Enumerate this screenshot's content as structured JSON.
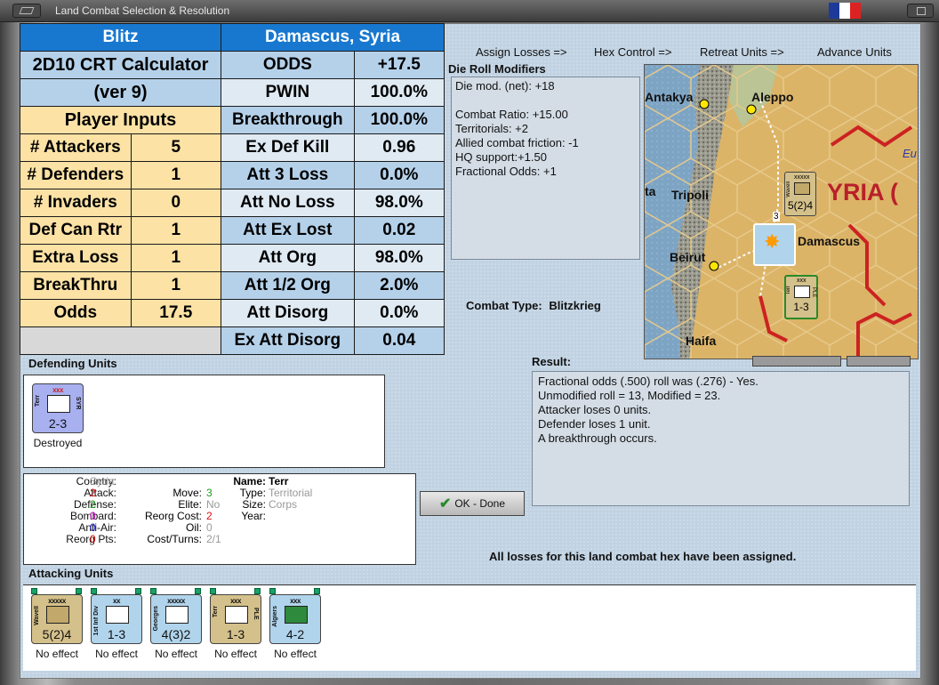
{
  "window": {
    "title": "Land Combat Selection & Resolution"
  },
  "crt": {
    "blitz": "Blitz",
    "location": "Damascus, Syria",
    "calc_title": "2D10 CRT Calculator",
    "calc_ver": "(ver 9)",
    "player_inputs": "Player Inputs",
    "inputs": [
      {
        "label": "# Attackers",
        "value": "5"
      },
      {
        "label": "# Defenders",
        "value": "1"
      },
      {
        "label": "# Invaders",
        "value": "0"
      },
      {
        "label": "Def Can Rtr",
        "value": "1"
      },
      {
        "label": "Extra Loss",
        "value": "1"
      },
      {
        "label": "BreakThru",
        "value": "1"
      },
      {
        "label": "Odds",
        "value": "17.5"
      }
    ],
    "results": [
      {
        "label": "ODDS",
        "value": "+17.5"
      },
      {
        "label": "PWIN",
        "value": "100.0%"
      },
      {
        "label": "Breakthrough",
        "value": "100.0%"
      },
      {
        "label": "Ex Def Kill",
        "value": "0.96"
      },
      {
        "label": "Att 3 Loss",
        "value": "0.0%"
      },
      {
        "label": "Att No Loss",
        "value": "98.0%"
      },
      {
        "label": "Att Ex Lost",
        "value": "0.02"
      },
      {
        "label": "Att Org",
        "value": "98.0%"
      },
      {
        "label": "Att 1/2 Org",
        "value": "2.0%"
      },
      {
        "label": "Att Disorg",
        "value": "0.0%"
      },
      {
        "label": "Ex Att Disorg",
        "value": "0.04"
      }
    ]
  },
  "actions": {
    "assign_losses": "Assign Losses =>",
    "hex_control": "Hex Control =>",
    "retreat_units": "Retreat Units =>",
    "advance_units": "Advance Units"
  },
  "modifiers": {
    "title": "Die Roll Modifiers",
    "lines": [
      "Die mod. (net): +18",
      "",
      "Combat Ratio: +15.00",
      "Territorials: +2",
      "Allied combat friction: -1",
      "HQ support:+1.50",
      "Fractional Odds: +1"
    ]
  },
  "map": {
    "labels": {
      "antakya": "Antakya",
      "aleppo": "Aleppo",
      "tripoli": "Tripoli",
      "beirut": "Beirut",
      "damascus": "Damascus",
      "haifa": "Haifa",
      "syria": "YRIA (",
      "ta": "ta",
      "eu": "Eu"
    },
    "hq_strength": "5(2)4",
    "hq_size": "xxxxx",
    "hq_name": "Wavell",
    "terr_strength": "1-3",
    "terr_size": "xxx",
    "terr_name": "Terr",
    "terr_country": "PLE",
    "stack_count": "3"
  },
  "combat": {
    "label": "Combat Type:",
    "value": "Blitzkrieg"
  },
  "defending": {
    "title": "Defending Units",
    "units": [
      {
        "size": "xxx",
        "name": "Terr",
        "country": "SYR",
        "strength": "2-3",
        "status": "Destroyed"
      }
    ]
  },
  "unit_info": {
    "country_label": "Country:",
    "country": "Syria",
    "attack_label": "Attack:",
    "attack": "2",
    "defense_label": "Defense:",
    "defense": "2",
    "bombard_label": "Bombard:",
    "bombard": "0",
    "antiair_label": "Anti-Air:",
    "antiair": "0",
    "reorgpts_label": "Reorg Pts:",
    "reorgpts": "0",
    "move_label": "Move:",
    "move": "3",
    "elite_label": "Elite:",
    "elite": "No",
    "reorgcost_label": "Reorg Cost:",
    "reorgcost": "2",
    "oil_label": "Oil:",
    "oil": "0",
    "costturns_label": "Cost/Turns:",
    "costturns": "2/1",
    "name_label": "Name:",
    "name": "Terr",
    "type_label": "Type:",
    "type": "Territorial",
    "size_label": "Size:",
    "size": "Corps",
    "year_label": "Year:",
    "year": ""
  },
  "result": {
    "title": "Result:",
    "lines": [
      "Fractional odds (.500) roll was (.276)  - Yes.",
      "Unmodified roll = 13, Modified = 23.",
      "Attacker loses 0 units.",
      "Defender loses 1 unit.",
      "A breakthrough occurs."
    ]
  },
  "ok_button": "OK - Done",
  "losses_message": "All losses for this land combat hex have been assigned.",
  "attacking": {
    "title": "Attacking Units",
    "marker": "V",
    "units": [
      {
        "size": "xxxxx",
        "name": "Wavell",
        "country": "",
        "strength": "5(2)4",
        "status": "No effect",
        "color": "#d4c08a"
      },
      {
        "size": "xx",
        "name": "1st Inf Div",
        "country": "",
        "strength": "1-3",
        "status": "No effect",
        "color": "#b0d4ec"
      },
      {
        "size": "xxxxx",
        "name": "Georges",
        "country": "",
        "strength": "4(3)2",
        "status": "No effect",
        "color": "#b0d4ec"
      },
      {
        "size": "xxx",
        "name": "Terr",
        "country": "PLE",
        "strength": "1-3",
        "status": "No effect",
        "color": "#d4c08a"
      },
      {
        "size": "xxx",
        "name": "Algiers",
        "country": "",
        "strength": "4-2",
        "status": "No effect",
        "color": "#b0d4ec"
      }
    ]
  }
}
